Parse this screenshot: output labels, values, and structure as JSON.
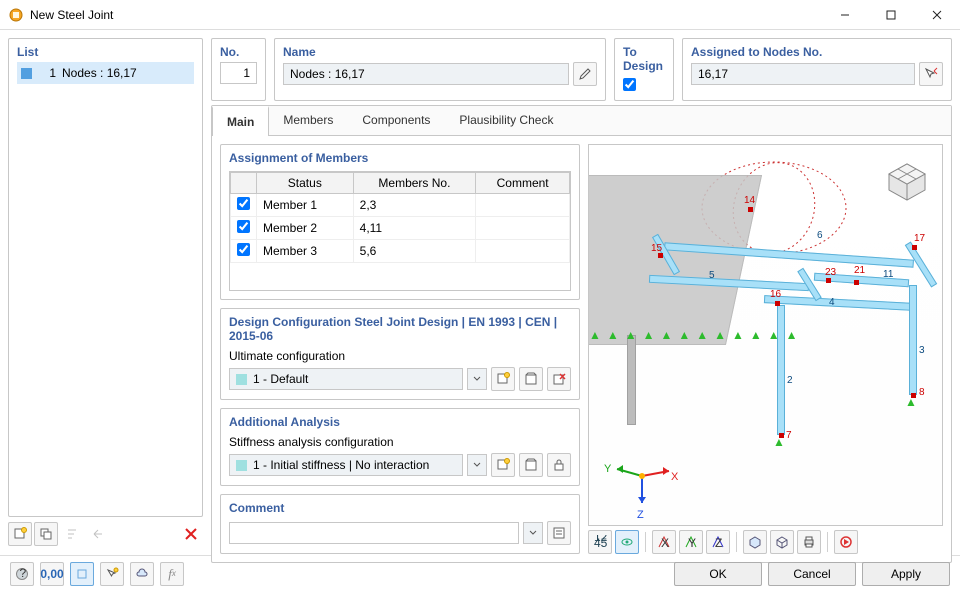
{
  "window": {
    "title": "New Steel Joint"
  },
  "list": {
    "label": "List",
    "item_num": "1",
    "item_text": "Nodes : 16,17"
  },
  "header": {
    "no_label": "No.",
    "no_value": "1",
    "name_label": "Name",
    "name_value": "Nodes : 16,17",
    "todesign_label": "To Design",
    "assigned_label": "Assigned to Nodes No.",
    "assigned_value": "16,17"
  },
  "tabs": {
    "main": "Main",
    "members": "Members",
    "components": "Components",
    "plausibility": "Plausibility Check"
  },
  "assign": {
    "title": "Assignment of Members",
    "cols": [
      "",
      "Status",
      "Members No.",
      "Comment"
    ],
    "rows": [
      {
        "checked": true,
        "status": "Member 1",
        "members": "2,3",
        "comment": ""
      },
      {
        "checked": true,
        "status": "Member 2",
        "members": "4,11",
        "comment": ""
      },
      {
        "checked": true,
        "status": "Member 3",
        "members": "5,6",
        "comment": ""
      }
    ]
  },
  "design": {
    "title": "Design Configuration  Steel Joint Design | EN 1993 | CEN | 2015-06",
    "sub": "Ultimate configuration",
    "value": "1 - Default"
  },
  "additional": {
    "title": "Additional Analysis",
    "sub": "Stiffness analysis configuration",
    "value": "1 - Initial stiffness | No interaction"
  },
  "comment": {
    "title": "Comment"
  },
  "viewer": {
    "nodes": {
      "14": "14",
      "15": "15",
      "16": "16",
      "17": "17",
      "21": "21",
      "23": "23",
      "7": "7",
      "8": "8"
    },
    "members": {
      "2": "2",
      "3": "3",
      "4": "4",
      "5": "5",
      "6": "6",
      "11": "11"
    },
    "axes": {
      "x": "X",
      "y": "Y",
      "z": "Z"
    },
    "coord": "1 2 3"
  },
  "buttons": {
    "ok": "OK",
    "cancel": "Cancel",
    "apply": "Apply"
  },
  "blv": {
    "v": "0,00"
  }
}
